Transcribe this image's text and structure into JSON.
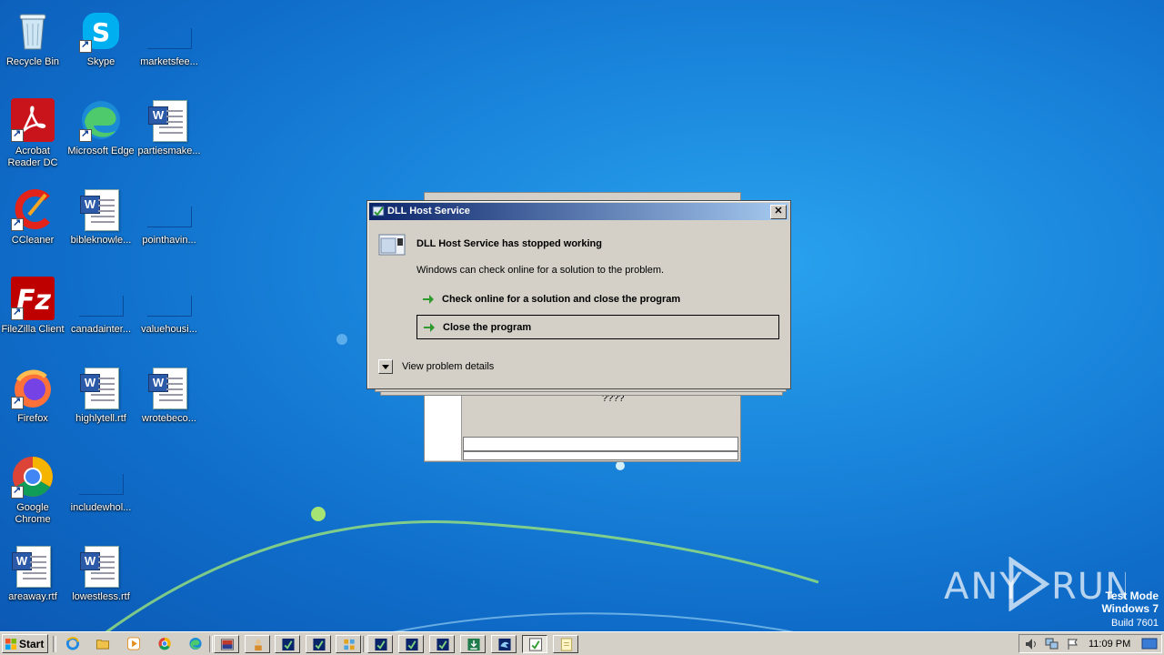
{
  "desktop": {
    "icons": [
      {
        "label": "Recycle Bin"
      },
      {
        "label": "Skype"
      },
      {
        "label": "marketsfee..."
      },
      {
        "label": "Acrobat Reader DC"
      },
      {
        "label": "Microsoft Edge"
      },
      {
        "label": "partiesmake..."
      },
      {
        "label": "CCleaner"
      },
      {
        "label": "bibleknowle..."
      },
      {
        "label": "pointhavin..."
      },
      {
        "label": "FileZilla Client"
      },
      {
        "label": "canadainter..."
      },
      {
        "label": "valuehousi..."
      },
      {
        "label": "Firefox"
      },
      {
        "label": "highlytell.rtf"
      },
      {
        "label": "wrotebeco..."
      },
      {
        "label": "Google Chrome"
      },
      {
        "label": "includewhol..."
      },
      {
        "label": "areaway.rtf"
      },
      {
        "label": "lowestless.rtf"
      }
    ]
  },
  "background_window": {
    "text": "????"
  },
  "dialog": {
    "title": "DLL Host Service",
    "close_glyph": "✕",
    "headline": "DLL Host Service has stopped working",
    "subtext": "Windows can check online for a solution to the problem.",
    "option_check_online": "Check online for a solution and close the program",
    "option_close": "Close the program",
    "details_label": "View problem details"
  },
  "watermark": {
    "brand": "ANY RUN",
    "line1": "Test Mode",
    "line2": "Windows 7",
    "line3": "Build 7601"
  },
  "taskbar": {
    "start_label": "Start",
    "clock": "11:09 PM"
  },
  "colors": {
    "titlebar_start": "#0a246a",
    "titlebar_end": "#a6caf0",
    "dialog_bg": "#d4d0c8",
    "desktop_bg": "#1a86dc",
    "go_arrow": "#2e9a2e"
  }
}
